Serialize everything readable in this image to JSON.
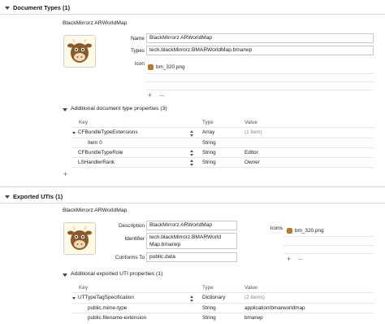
{
  "document_types": {
    "header": "Document Types (1)",
    "name_title": "BlackMirrorz ARWorldMap",
    "labels": {
      "name": "Name",
      "types": "Types",
      "icon": "Icon"
    },
    "name_value": "BlackMirrorz ARWorldMap",
    "types_value": "tech.blackMirrorz.BMARWorldMap.bmarwp",
    "icon_value": "bm_320.png",
    "additional_title": "Additional document type properties (3)",
    "table": {
      "headers": [
        "Key",
        "Type",
        "Value"
      ],
      "rows": [
        {
          "key": "CFBundleTypeExtensions",
          "type": "Array",
          "value": "(1 item)"
        },
        {
          "key": "Item 0",
          "type": "String",
          "value": ""
        },
        {
          "key": "CFBundleTypeRole",
          "type": "String",
          "value": "Editor"
        },
        {
          "key": "LSHandlerRank",
          "type": "String",
          "value": "Owner"
        }
      ]
    },
    "add_symbol": "+",
    "remove_symbol": "—"
  },
  "exported_utis": {
    "header": "Exported UTIs (1)",
    "name_title": "BlackMirrorz ARWorldMap",
    "labels": {
      "description": "Description",
      "identifier": "Identifier",
      "conforms_to": "Conforms To",
      "icons": "Icons"
    },
    "description_value": "BlackMirrorz ARWorldMap",
    "identifier_line1": "tech.blackMirrorz.BMARWorld",
    "identifier_line2": "Map.bmarwp",
    "conforms_value": "public.data",
    "icons_value": "bm_320.png",
    "additional_title": "Additional exported UTI properties (1)",
    "table": {
      "headers": [
        "Key",
        "Type",
        "Value"
      ],
      "rows": [
        {
          "key": "UTTypeTagSpecification",
          "type": "Dictionary",
          "value": "(2 items)"
        },
        {
          "key": "public.mime-type",
          "type": "String",
          "value": "application/bmarworldmap"
        },
        {
          "key": "public.filename-extension",
          "type": "String",
          "value": "bmarwp"
        }
      ]
    },
    "add_symbol": "+",
    "remove_symbol": "—"
  },
  "colors": {
    "icon_brown": "#8a5a2b",
    "icon_bg": "#fffbe6"
  }
}
